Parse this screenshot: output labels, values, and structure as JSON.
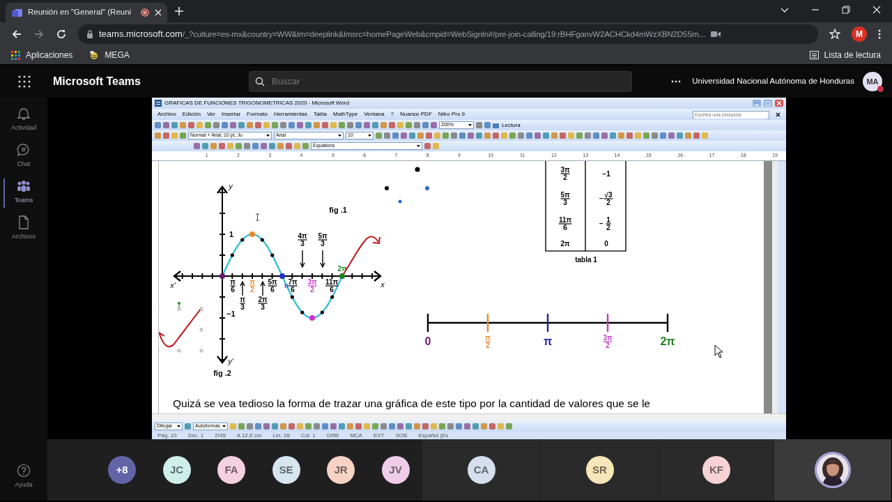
{
  "browser": {
    "tab_title": "Reunión en \"General\" (Reuni",
    "recording": true,
    "url_host": "teams.microsoft.com",
    "url_path": "/_?culture=es-mx&country=WW&lm=deeplink&lmsrc=homePageWeb&cmpid=WebSignIn#/pre-join-calling/19:rBHFganvW2ACHCkd4mWzXBN2D5Sm...",
    "profile_initial": "M",
    "bookmarks": [
      {
        "label": "Aplicaciones",
        "kind": "apps"
      },
      {
        "label": "MEGA",
        "kind": "mega"
      }
    ],
    "reading_list": "Lista de lectura"
  },
  "teams": {
    "app_name": "Microsoft Teams",
    "search_placeholder": "Buscar",
    "org": "Universidad Nacional Autónoma de Honduras",
    "user_initials": "MA",
    "rail": [
      {
        "label": "Actividad",
        "kind": "bell",
        "selected": false
      },
      {
        "label": "Chat",
        "kind": "chat",
        "selected": false
      },
      {
        "label": "Teams",
        "kind": "teams",
        "selected": true
      },
      {
        "label": "Archivos",
        "kind": "file",
        "selected": false
      }
    ],
    "help": "Ayuda"
  },
  "word": {
    "title": "GRAFICAS DE FUNCIONES TRIGONOMETRICAS 2020 - Microsoft Word",
    "menu": [
      "Archivo",
      "Edición",
      "Ver",
      "Insertar",
      "Formato",
      "Herramientas",
      "Tabla",
      "MathType",
      "Ventana",
      "?",
      "Nuance PDF",
      "Nitro Pro 9"
    ],
    "help_placeholder": "Escriba una pregunta",
    "zoom": "200%",
    "reading": "Lectura",
    "style": "Normal + Arial, 10 pt, Ju",
    "font": "Arial",
    "size": "10",
    "equations": "Equations",
    "ruler": [
      "1",
      "2",
      "3",
      "4",
      "5",
      "6",
      "7",
      "8",
      "9",
      "10",
      "11",
      "12",
      "13",
      "14",
      "15",
      "16",
      "17",
      "18",
      "19"
    ],
    "figure": {
      "fig1": "fig .1",
      "fig2": "fig .2",
      "x_label": "x",
      "x_neg_label": "x'",
      "y_label": "y",
      "y_neg_label": "y'",
      "y_ticks": [
        "1",
        "−1"
      ],
      "key_points": [
        {
          "color": "#6a1b6a"
        },
        {
          "color": "#e6892c"
        },
        {
          "color": "#1f2fd0"
        },
        {
          "color": "#d030d0"
        },
        {
          "color": "#1f7f1f"
        }
      ],
      "below_labels": [
        {
          "num": "π",
          "den": "6"
        },
        {
          "num": "π",
          "den": "2",
          "color": "#e6892c"
        },
        {
          "num": "5π",
          "den": "6"
        },
        {
          "text": "π",
          "color": "#3a4fd0"
        },
        {
          "num": "7π",
          "den": "6"
        },
        {
          "num": "3π",
          "den": "2",
          "color": "#c43cc4"
        },
        {
          "num": "11π",
          "den": "6"
        }
      ],
      "up_arrow_labels": [
        {
          "num": "π",
          "den": "3"
        },
        {
          "num": "2π",
          "den": "3"
        }
      ],
      "down_arrow_labels": [
        {
          "num": "4π",
          "den": "3"
        },
        {
          "num": "5π",
          "den": "3"
        }
      ],
      "end_label": {
        "text": "2π",
        "color": "#1f7f1f"
      }
    },
    "table": {
      "caption": "tabla 1",
      "rows": [
        {
          "angle": {
            "num": "3π",
            "den": "2"
          },
          "value": {
            "text": "−1"
          }
        },
        {
          "angle": {
            "num": "5π",
            "den": "3"
          },
          "value": {
            "sign": "−",
            "num": "√3",
            "den": "2"
          }
        },
        {
          "angle": {
            "num": "11π",
            "den": "6"
          },
          "value": {
            "sign": "−",
            "num": "1",
            "den": "2"
          }
        },
        {
          "angle": {
            "text": "2π"
          },
          "value": {
            "text": "0"
          }
        }
      ]
    },
    "number_line": [
      {
        "label": {
          "text": "0"
        },
        "color": "#6a1b6a"
      },
      {
        "label": {
          "num": "π",
          "den": "2"
        },
        "color": "#e6892c"
      },
      {
        "label": {
          "text": "π"
        },
        "color": "#1f1fa0"
      },
      {
        "label": {
          "num": "3π",
          "den": "2"
        },
        "color": "#c43cc4"
      },
      {
        "label": {
          "text": "2π"
        },
        "color": "#1f7f1f"
      }
    ],
    "paragraph": "Quizá se vea tedioso la forma de trazar una gráfica de este tipo por la cantidad de valores que se le",
    "draw_menu": "Dibujar",
    "autoshapes": "Autoformas",
    "status": [
      "Pág. 10",
      "Sec. 1",
      "2/45",
      "A 12,6 cm",
      "Lín. 28",
      "Col. 1",
      "GRB",
      "MCA",
      "EXT",
      "SOB",
      "Español (Es"
    ]
  },
  "participants": [
    {
      "initials": "+8",
      "color": "#6264a7"
    },
    {
      "initials": "JC",
      "color": "#cdeee9"
    },
    {
      "initials": "FA",
      "color": "#f5d0e0"
    },
    {
      "initials": "SE",
      "color": "#d6e6ef"
    },
    {
      "initials": "JR",
      "color": "#f7d3c5"
    },
    {
      "initials": "JV",
      "color": "#efcde8"
    }
  ],
  "tiles": [
    {
      "kind": "initials",
      "initials": "CA",
      "color": "#d5deec"
    },
    {
      "kind": "initials",
      "initials": "SR",
      "color": "#f6e6b8"
    },
    {
      "kind": "initials",
      "initials": "KF",
      "color": "#f7d3d6"
    },
    {
      "kind": "picture"
    }
  ]
}
